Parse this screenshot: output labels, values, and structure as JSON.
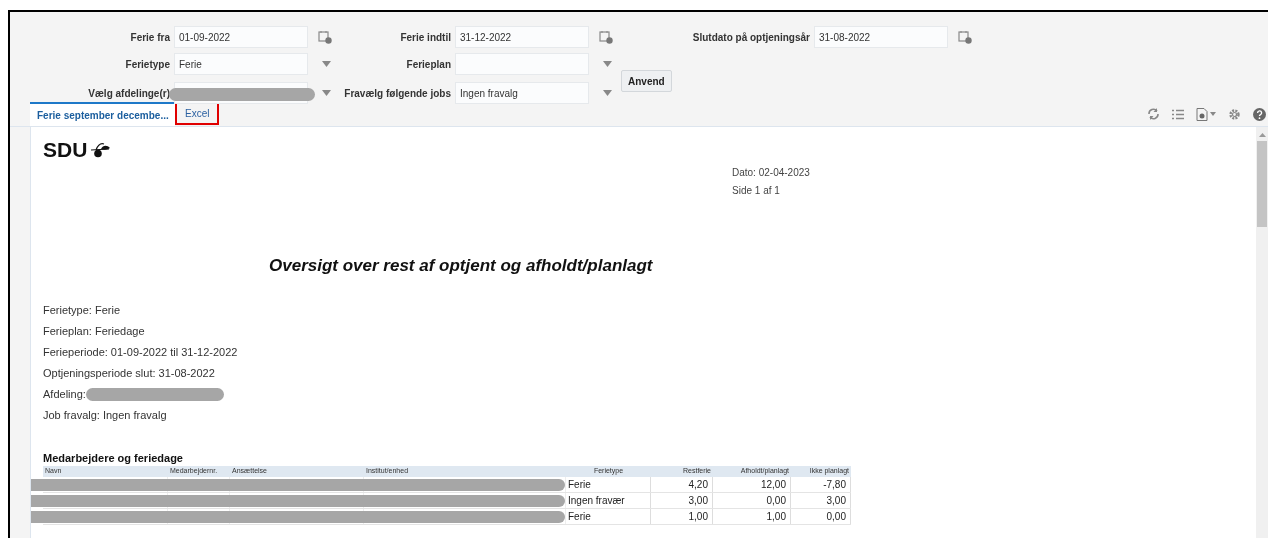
{
  "parameters": [
    {
      "label": "Ferie fra",
      "kind": "date",
      "value": "01-09-2022"
    },
    {
      "label": "Ferie indtil",
      "kind": "date",
      "value": "31-12-2022"
    },
    {
      "label": "Slutdato på optjeningsår",
      "kind": "date",
      "value": "31-08-2022"
    },
    {
      "label": "Ferietype",
      "kind": "select",
      "value": "Ferie"
    },
    {
      "label": "Ferieplan",
      "kind": "select"
    },
    {
      "label": "Vælg afdelinge(r)",
      "kind": "select",
      "redacted": true
    },
    {
      "label": "Fravælg følgende jobs",
      "kind": "select",
      "value": "Ingen fravalg"
    }
  ],
  "apply_button": "Anvend",
  "tabs": [
    {
      "label": "Ferie september decembe...",
      "selected": true,
      "outlined": false
    },
    {
      "label": "Excel",
      "selected": false,
      "outlined": true
    }
  ],
  "report": {
    "logo": "SDU",
    "date": "Dato: 02-04-2023",
    "page": "Side 1 af 1",
    "title": "Oversigt over rest af optjent og afholdt/planlagt",
    "info": [
      {
        "text": "Ferietype: Ferie"
      },
      {
        "text": "Ferieplan: Feriedage"
      },
      {
        "text": "Ferieperiode: 01-09-2022 til  31-12-2022"
      },
      {
        "text": "Optjeningsperiode slut: 31-08-2022"
      },
      {
        "text": "Afdeling:",
        "redacted": true
      },
      {
        "text": "Job fravalg: Ingen fravalg"
      }
    ],
    "section_title": "Medarbejdere og feriedage",
    "table": {
      "columns": [
        "Navn",
        "Medarbejdernr.",
        "Ansættelse",
        "Institut/enhed",
        "Ferietype",
        "Restferie",
        "Afholdt/planlagt",
        "Ikke planlagt"
      ],
      "rows": [
        {
          "ferietype": "Ferie",
          "restferie": "4,20",
          "afholdt": "12,00",
          "ikke_planlagt": "-7,80"
        },
        {
          "ferietype": "Ingen fravær",
          "restferie": "3,00",
          "afholdt": "0,00",
          "ikke_planlagt": "3,00"
        },
        {
          "ferietype": "Ferie",
          "restferie": "1,00",
          "afholdt": "1,00",
          "ikke_planlagt": "0,00"
        }
      ]
    }
  }
}
